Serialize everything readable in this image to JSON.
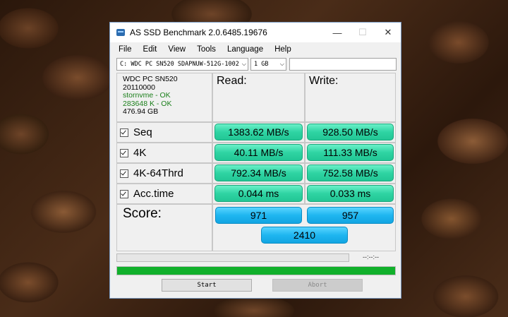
{
  "window": {
    "title": "AS SSD Benchmark 2.0.6485.19676"
  },
  "menu": [
    "File",
    "Edit",
    "View",
    "Tools",
    "Language",
    "Help"
  ],
  "toolbar": {
    "drive": "C: WDC PC SN520 SDAPNUW-512G-1002",
    "size": "1 GB",
    "extra": ""
  },
  "drive_info": {
    "model": "WDC PC SN520",
    "firmware": "20110000",
    "driver": "stornvme - OK",
    "alignment": "283648 K - OK",
    "capacity": "476.94 GB"
  },
  "headers": {
    "read": "Read:",
    "write": "Write:"
  },
  "rows": [
    {
      "label": "Seq",
      "read": "1383.62 MB/s",
      "write": "928.50 MB/s"
    },
    {
      "label": "4K",
      "read": "40.11 MB/s",
      "write": "111.33 MB/s"
    },
    {
      "label": "4K-64Thrd",
      "read": "792.34 MB/s",
      "write": "752.58 MB/s"
    },
    {
      "label": "Acc.time",
      "read": "0.044 ms",
      "write": "0.033 ms"
    }
  ],
  "score": {
    "label": "Score:",
    "read": "971",
    "write": "957",
    "total": "2410"
  },
  "status": {
    "elapsed": "--:--:--",
    "progress": 1.0
  },
  "buttons": {
    "start": "Start",
    "abort": "Abort"
  },
  "colors": {
    "result_green": "#2fd4a3",
    "score_blue": "#1fb6f0",
    "progress_green": "#11b02b"
  }
}
